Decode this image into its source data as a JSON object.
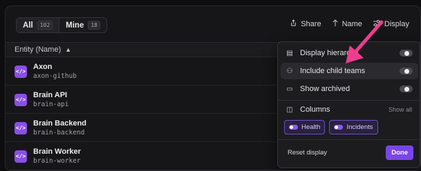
{
  "filters": {
    "all": {
      "label": "All",
      "count": "102"
    },
    "mine": {
      "label": "Mine",
      "count": "18"
    }
  },
  "actions": {
    "share": {
      "label": "Share",
      "icon": "share-icon"
    },
    "name": {
      "label": "Name",
      "icon": "arrow-up-icon"
    },
    "display": {
      "label": "Display",
      "icon": "sliders-icon"
    }
  },
  "table": {
    "header": "Entity (Name)",
    "rows": [
      {
        "name": "Axon",
        "tag": "axon-github"
      },
      {
        "name": "Brain API",
        "tag": "brain-api"
      },
      {
        "name": "Brain Backend",
        "tag": "brain-backend"
      },
      {
        "name": "Brain Worker",
        "tag": "brain-worker"
      }
    ],
    "icon_glyph": "</>"
  },
  "display_menu": {
    "items": [
      {
        "label": "Display hierarchy",
        "icon": "hierarchy-icon",
        "toggled": false
      },
      {
        "label": "Include child teams",
        "icon": "team-icon",
        "toggled": false
      },
      {
        "label": "Show archived",
        "icon": "archive-icon",
        "toggled": false
      }
    ],
    "columns": {
      "label": "Columns",
      "show_all": "Show all",
      "chips": [
        {
          "label": "Health",
          "on": true
        },
        {
          "label": "Incidents",
          "on": true
        }
      ]
    },
    "reset_label": "Reset display",
    "done_label": "Done"
  },
  "colors": {
    "accent": "#7a45e8",
    "entity_icon": "#8a4fe6",
    "annotation_arrow": "#ee3d8f"
  }
}
